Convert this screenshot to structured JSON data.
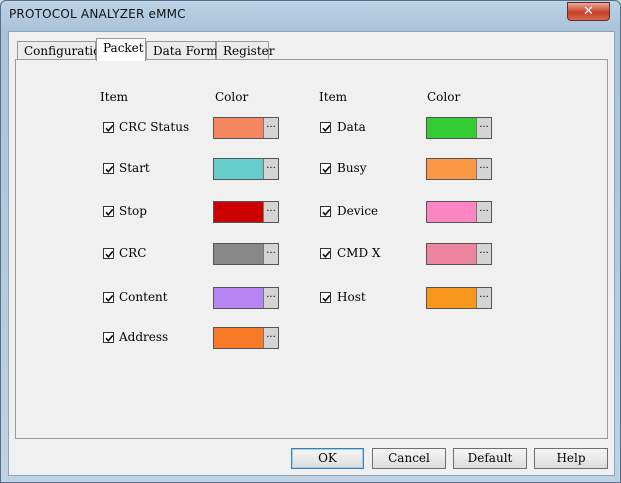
{
  "window": {
    "title": "PROTOCOL ANALYZER eMMC",
    "close_glyph": "✕"
  },
  "tabs": [
    {
      "label": "Configuration"
    },
    {
      "label": "Packet"
    },
    {
      "label": "Data Format"
    },
    {
      "label": "Register"
    }
  ],
  "headers": {
    "item_left": "Item",
    "color_left": "Color",
    "item_right": "Item",
    "color_right": "Color"
  },
  "left_items": [
    {
      "label": "CRC Status",
      "checked": true,
      "color": "#f4875f"
    },
    {
      "label": "Start",
      "checked": true,
      "color": "#66cccc"
    },
    {
      "label": "Stop",
      "checked": true,
      "color": "#cc0000"
    },
    {
      "label": "CRC",
      "checked": true,
      "color": "#888888"
    },
    {
      "label": "Content",
      "checked": true,
      "color": "#b885f5"
    },
    {
      "label": "Address",
      "checked": true,
      "color": "#f87a26"
    }
  ],
  "right_items": [
    {
      "label": "Data",
      "checked": true,
      "color": "#33cc33"
    },
    {
      "label": "Busy",
      "checked": true,
      "color": "#fc9744"
    },
    {
      "label": "Device",
      "checked": true,
      "color": "#fc85c2"
    },
    {
      "label": "CMD X",
      "checked": true,
      "color": "#ee85a0"
    },
    {
      "label": "Host",
      "checked": true,
      "color": "#f8971c"
    }
  ],
  "picker_glyph": "...",
  "buttons": {
    "ok": "OK",
    "cancel": "Cancel",
    "default": "Default",
    "help": "Help"
  }
}
